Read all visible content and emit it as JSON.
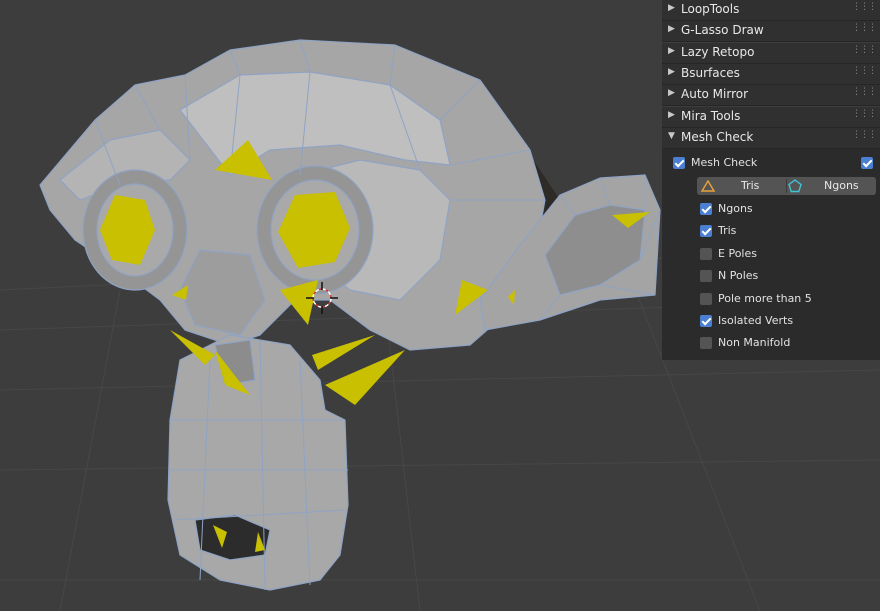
{
  "viewport": {
    "background": "#3d3d3d",
    "mesh_color": "#a8a8a8",
    "edge_color": "#8fa3c4",
    "highlight_color": "#c8c000",
    "cursor_icon": "3d-cursor-icon"
  },
  "sidebar": {
    "panels": [
      {
        "label": "LoopTools",
        "expanded": false
      },
      {
        "label": "G-Lasso Draw",
        "expanded": false
      },
      {
        "label": "Lazy Retopo",
        "expanded": false
      },
      {
        "label": "Bsurfaces",
        "expanded": false
      },
      {
        "label": "Auto Mirror",
        "expanded": false
      },
      {
        "label": "Mira Tools",
        "expanded": false
      },
      {
        "label": "Mesh Check",
        "expanded": true
      }
    ],
    "mesh_check": {
      "title": "Mesh Check",
      "enabled": true,
      "tabs": [
        {
          "label": "Tris",
          "icon": "triangle-icon",
          "color": "#e8a33a"
        },
        {
          "label": "Ngons",
          "icon": "pentagon-icon",
          "color": "#3fc4d4"
        }
      ],
      "options": [
        {
          "label": "Ngons",
          "checked": true
        },
        {
          "label": "Tris",
          "checked": true
        },
        {
          "label": "E Poles",
          "checked": false
        },
        {
          "label": "N Poles",
          "checked": false
        },
        {
          "label": "Pole more than 5",
          "checked": false
        },
        {
          "label": "Isolated Verts",
          "checked": true
        },
        {
          "label": "Non Manifold",
          "checked": false
        }
      ]
    }
  }
}
